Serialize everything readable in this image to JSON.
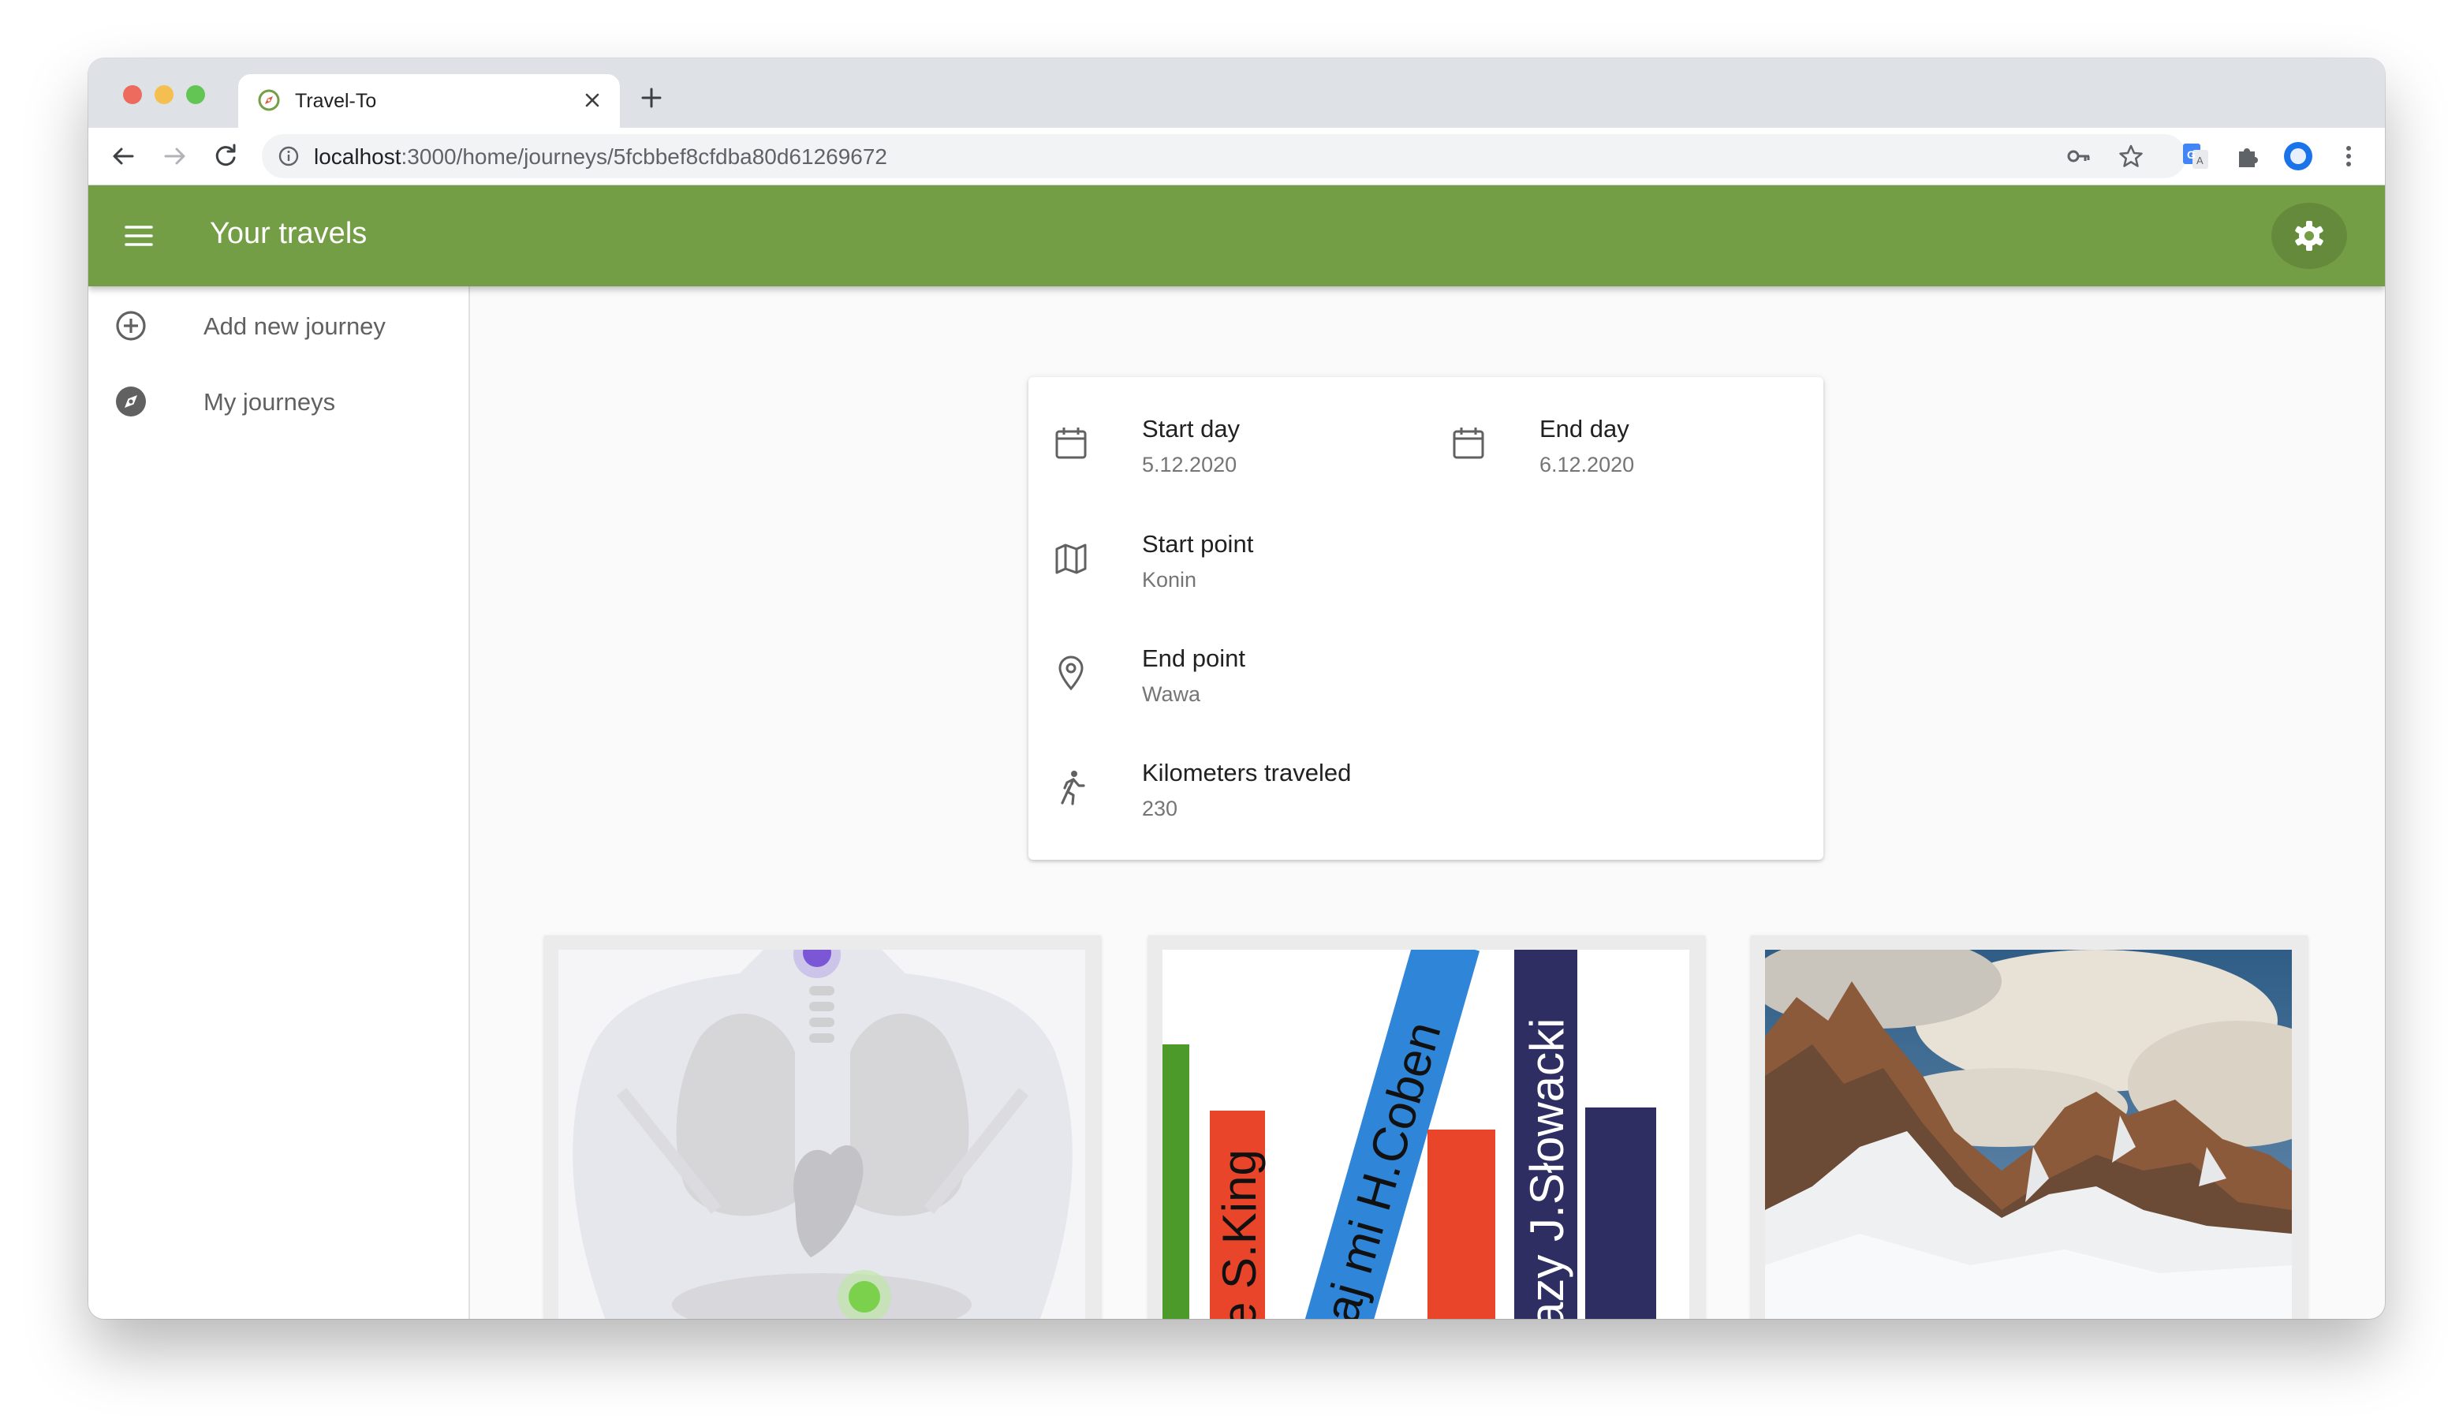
{
  "browser": {
    "tab_title": "Travel-To",
    "url_host": "localhost",
    "url_path": ":3000/home/journeys/5fcbbef8cfdba80d61269672"
  },
  "app": {
    "title": "Your travels",
    "accent_color": "#739e45"
  },
  "drawer": {
    "items": [
      {
        "label": "Add new journey",
        "icon": "add-circle-icon"
      },
      {
        "label": "My journeys",
        "icon": "compass-icon"
      }
    ]
  },
  "journey": {
    "start_day": {
      "label": "Start day",
      "value": "5.12.2020",
      "icon": "calendar-icon"
    },
    "end_day": {
      "label": "End day",
      "value": "6.12.2020",
      "icon": "calendar-icon"
    },
    "start_point": {
      "label": "Start point",
      "value": "Konin",
      "icon": "map-icon"
    },
    "end_point": {
      "label": "End point",
      "value": "Wawa",
      "icon": "location-pin-icon"
    },
    "kilometers": {
      "label": "Kilometers traveled",
      "value": "230",
      "icon": "running-person-icon"
    }
  },
  "photos": {
    "books": {
      "spine_1": "e S.King",
      "spine_2": "aj mi H.Coben",
      "spine_3": "azy J.Słowacki"
    }
  }
}
